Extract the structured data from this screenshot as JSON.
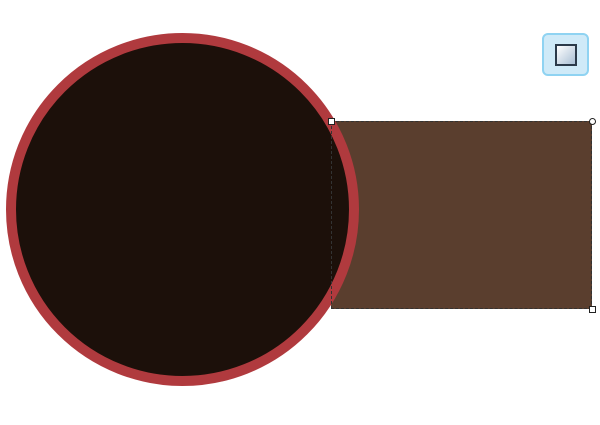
{
  "canvas": {
    "background": "#ffffff"
  },
  "shapes": {
    "rectangle": {
      "fill": "#5a3e2e",
      "selected": true
    },
    "circle": {
      "fill": "#1c100a",
      "stroke": "#b03a3e"
    }
  },
  "selection": {
    "frame_style": "dashed",
    "handles": [
      "top-left",
      "top-right",
      "bottom-right"
    ]
  },
  "toolbar": {
    "style_button_icon": "shape-style-icon",
    "accent": "#8fd3f2"
  }
}
